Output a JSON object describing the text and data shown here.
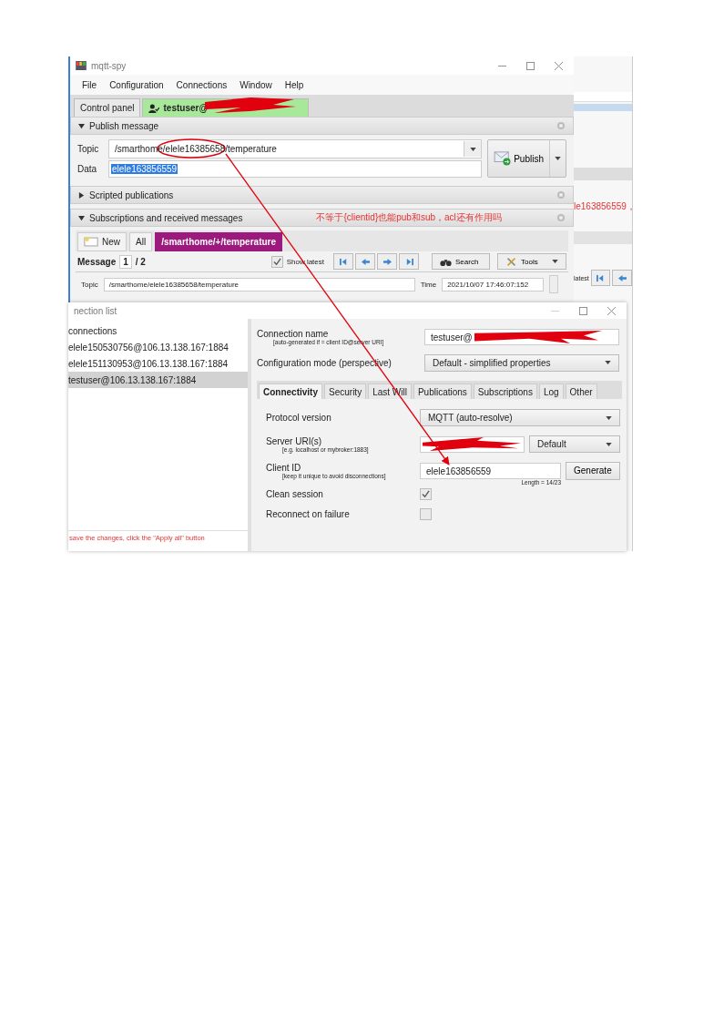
{
  "main_window": {
    "title": "mqtt-spy",
    "menu": [
      "File",
      "Configuration",
      "Connections",
      "Window",
      "Help"
    ],
    "tabs": [
      {
        "label": "Control panel",
        "selected": false
      },
      {
        "label": "testuser@",
        "selected": true
      }
    ],
    "publish": {
      "title": "Publish message",
      "expanded": true,
      "topic_label": "Topic",
      "topic": "/smarthome/elele16385658/temperature",
      "data_label": "Data",
      "data": "elele163856559",
      "button": "Publish"
    },
    "scripted": {
      "title": "Scripted publications",
      "expanded": false
    },
    "subscriptions": {
      "title": "Subscriptions and received messages",
      "expanded": true,
      "note": "不等于{clientid}也能pub和sub，acl还有作用吗",
      "tabs": [
        {
          "label": "New",
          "kind": "new",
          "selected": false
        },
        {
          "label": "All",
          "kind": "plain",
          "selected": false
        },
        {
          "label": "/smarthome/+/temperature",
          "kind": "subscription",
          "selected": true,
          "color": "#9c1a7d"
        }
      ],
      "message_label": "Message",
      "message_index": "1",
      "message_total": "/ 2",
      "show_latest": {
        "label": "Show latest",
        "checked": true
      },
      "search": "Search",
      "tools": "Tools",
      "topic_label": "Topic",
      "topic": "/smarthome/elele16385658/temperature",
      "time_label": "Time",
      "time": "2021/10/07 17:46:07:152"
    }
  },
  "background_window": {
    "note": "le163856559，",
    "latest": "latest"
  },
  "connection_window": {
    "title": "nection list",
    "tree_root": "connections",
    "connections": [
      {
        "label": "elele150530756@106.13.138.167:1884",
        "selected": false
      },
      {
        "label": "elele151130953@106.13.138.167:1884",
        "selected": false
      },
      {
        "label": "testuser@106.13.138.167:1884",
        "selected": true
      }
    ],
    "hint": "save the changes, click the \"Apply all\" button",
    "name_label": "Connection name",
    "name_hint": "[auto-generated if = client ID@server URI]",
    "name_value": "testuser@",
    "mode_label": "Configuration mode (perspective)",
    "mode": "Default - simplified properties",
    "tabs": [
      {
        "label": "Connectivity",
        "selected": true
      },
      {
        "label": "Security",
        "selected": false
      },
      {
        "label": "Last Will",
        "selected": false
      },
      {
        "label": "Publications",
        "selected": false
      },
      {
        "label": "Subscriptions",
        "selected": false
      },
      {
        "label": "Log",
        "selected": false
      },
      {
        "label": "Other",
        "selected": false
      }
    ],
    "protocol_label": "Protocol version",
    "protocol": "MQTT (auto-resolve)",
    "server_label": "Server URI(s)",
    "server_hint": "[e.g. localhost or mybroker:1883]",
    "server_mode": "Default",
    "client_label": "Client ID",
    "client_hint": "[keep it unique to avoid disconnections]",
    "client_id": "elele163856559",
    "client_length": "Length = 14/23",
    "generate": "Generate",
    "clean_session": {
      "label": "Clean session",
      "checked": true
    },
    "reconnect": {
      "label": "Reconnect on failure",
      "checked": false
    }
  }
}
